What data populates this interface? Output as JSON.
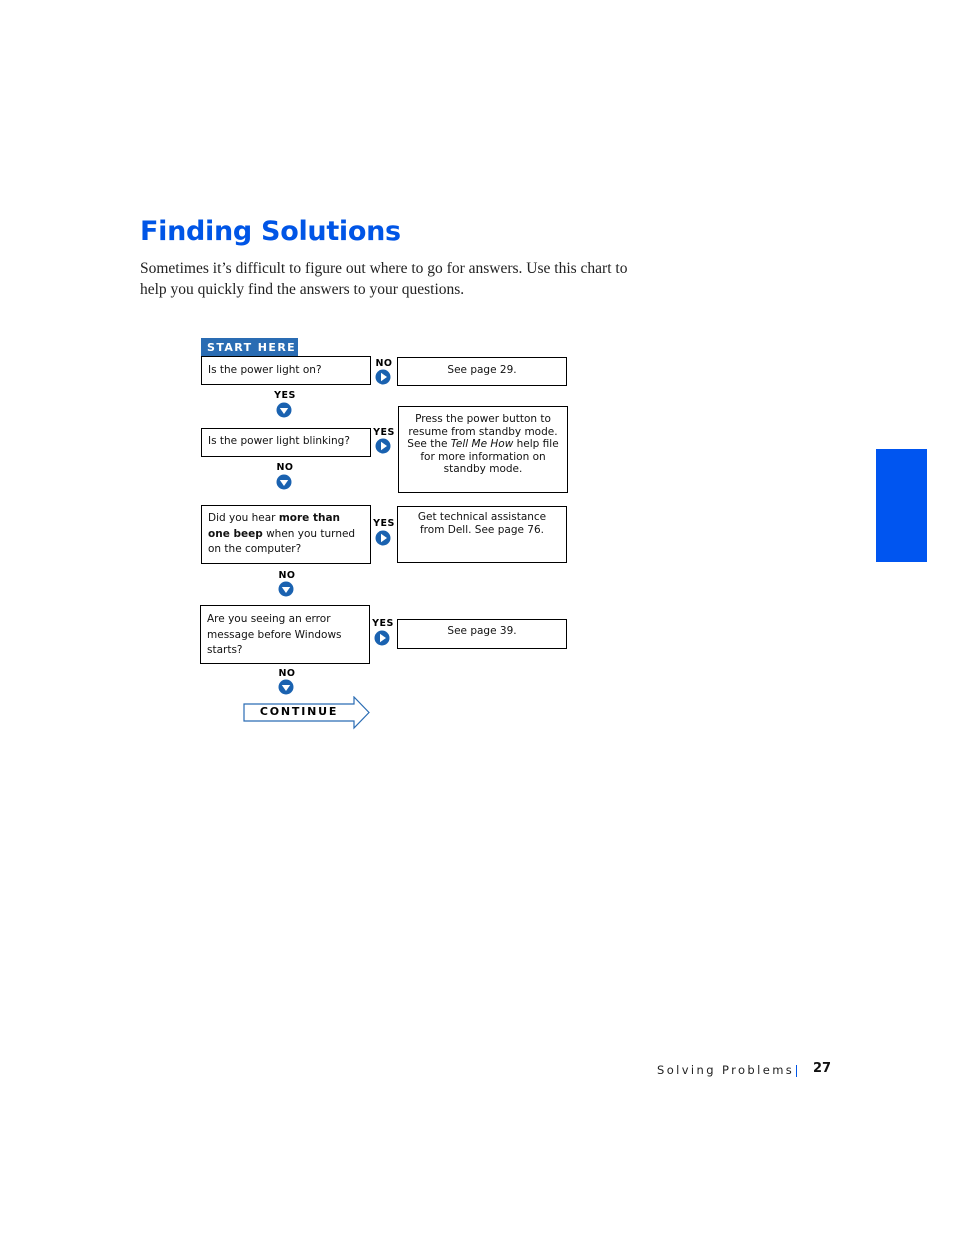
{
  "page": {
    "title": "Finding Solutions",
    "intro": "Sometimes it’s difficult to figure out where to go for answers. Use this chart to help you quickly find the answers to your questions.",
    "accent_color": "#0055e6",
    "side_tab_color": "#0055f0"
  },
  "flowchart": {
    "start_label": "START HERE",
    "arrow_color": "#1a62b0",
    "steps": [
      {
        "question": "Is the power light on?",
        "branch_label": "NO",
        "answer": "See page 29.",
        "down_label": "YES"
      },
      {
        "question": "Is the power light blinking?",
        "branch_label": "YES",
        "answer_parts": {
          "before": "Press the power button to resume from standby mode. See the ",
          "italic": "Tell Me How",
          "after": " help file for more information on standby mode."
        },
        "down_label": "NO"
      },
      {
        "question_parts": {
          "before": "Did you hear ",
          "bold1": "more than one beep",
          "after": " when you turned on the computer?"
        },
        "branch_label": "YES",
        "answer": "Get technical assistance from Dell. See page 76.",
        "down_label": "NO"
      },
      {
        "question": "Are you seeing an error message before Windows starts?",
        "branch_label": "YES",
        "answer": "See page 39.",
        "down_label": "NO"
      }
    ],
    "continue_label": "CONTINUE"
  },
  "footer": {
    "section": "Solving Problems",
    "page_number": "27"
  }
}
